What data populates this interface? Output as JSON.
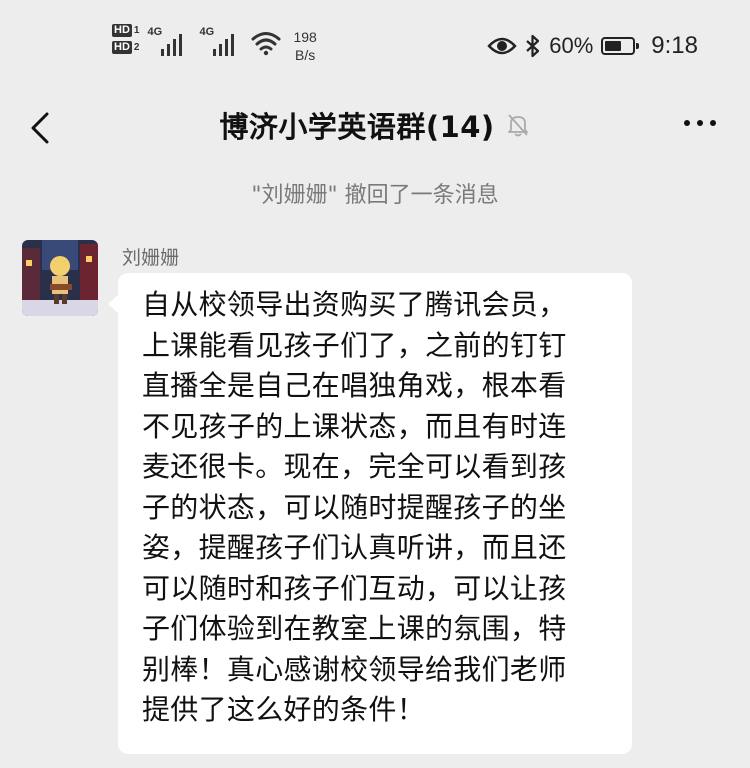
{
  "status_bar": {
    "hd1": "HD",
    "hd1_sim": "1",
    "hd2": "HD",
    "hd2_sim": "2",
    "net1": "4G",
    "net2": "4G",
    "speed_value": "198",
    "speed_unit": "B/s",
    "battery_percent": "60%",
    "battery_level": 0.6,
    "time": "9:18"
  },
  "header": {
    "title": "博济小学英语群(14)"
  },
  "notice": "\"刘姗姗\" 撤回了一条消息",
  "message": {
    "sender": "刘姗姗",
    "lines": [
      "自从校领导出资购买了腾讯会员，",
      "上课能看见孩子们了，之前的钉钉",
      "直播全是自己在唱独角戏，根本看",
      "不见孩子的上课状态，而且有时连",
      "麦还很卡。现在，完全可以看到孩",
      "子的状态，可以随时提醒孩子的坐",
      "姿，提醒孩子们认真听讲，而且还",
      "可以随时和孩子们互动，可以让孩",
      "子们体验到在教室上课的氛围，特",
      "别棒！真心感谢校领导给我们老师",
      "提供了这么好的条件！"
    ]
  },
  "icons": {
    "back": "chevron-left-icon",
    "mute": "bell-off-icon",
    "more": "more-dots-icon",
    "eye": "eye-icon",
    "bluetooth": "bluetooth-icon",
    "wifi": "wifi-icon",
    "battery": "battery-icon"
  },
  "colors": {
    "background": "#ededed",
    "bubble": "#ffffff",
    "notice_text": "#7a7a7a",
    "sender_text": "#6b6b6b"
  }
}
